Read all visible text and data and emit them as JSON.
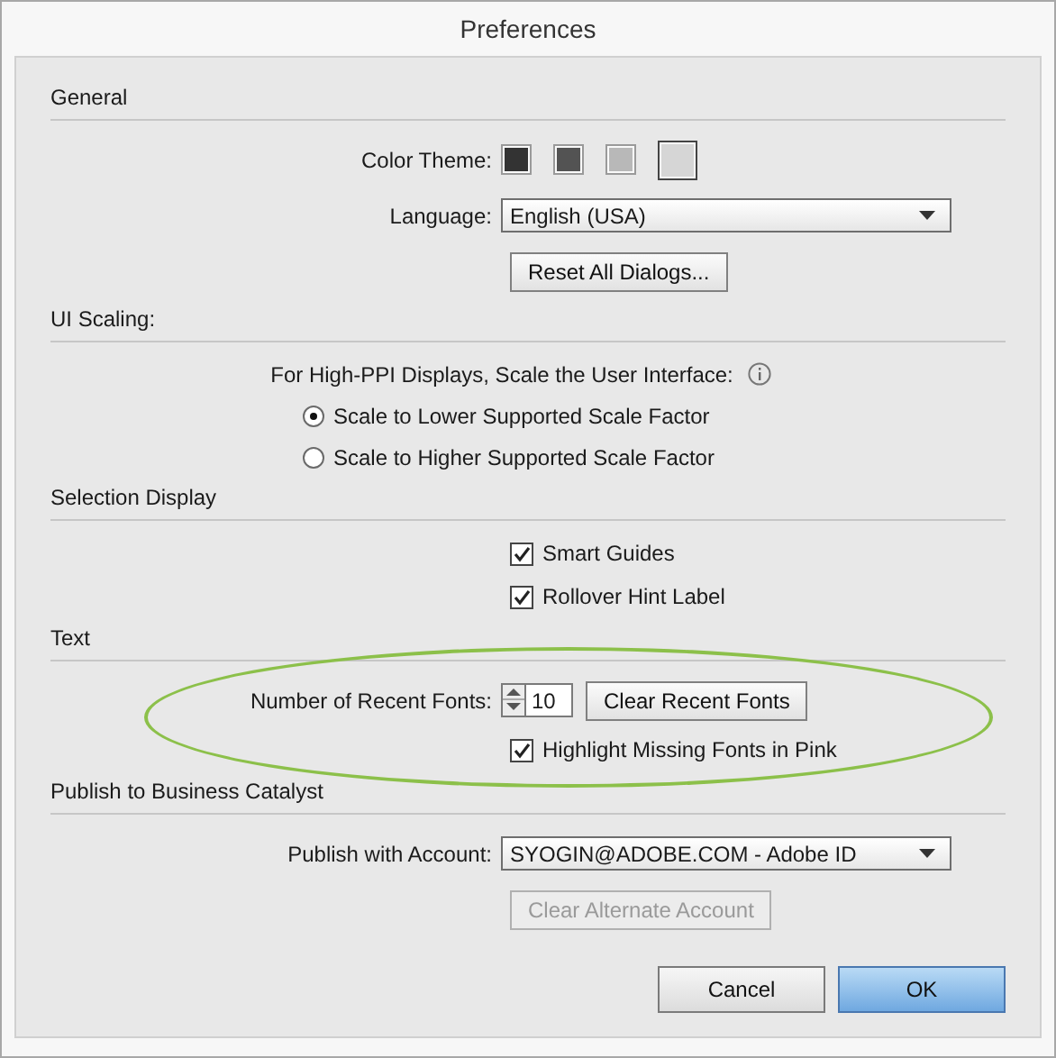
{
  "window": {
    "title": "Preferences"
  },
  "sections": [
    {
      "title": "General",
      "highlighted": false,
      "rows": [
        {
          "kind": "swatches",
          "label": "Color Theme:",
          "swatches": [
            {
              "color": "#333333",
              "selected": false
            },
            {
              "color": "#535353",
              "selected": false
            },
            {
              "color": "#b8b8b8",
              "selected": false
            },
            {
              "color": "#d6d6d6",
              "selected": true
            }
          ]
        },
        {
          "kind": "dropdown",
          "label": "Language:",
          "value": "English (USA)"
        },
        {
          "kind": "button",
          "text": "Reset All Dialogs...",
          "disabled": false
        }
      ]
    },
    {
      "title": "UI Scaling:",
      "highlighted": false,
      "rows": [
        {
          "kind": "note",
          "text": "For High-PPI Displays, Scale the User Interface:"
        },
        {
          "kind": "radio",
          "text": "Scale to Lower Supported Scale Factor",
          "selected": true
        },
        {
          "kind": "radio",
          "text": "Scale to Higher Supported Scale Factor",
          "selected": false
        }
      ]
    },
    {
      "title": "Selection Display",
      "highlighted": false,
      "rows": [
        {
          "kind": "checkbox",
          "text": "Smart Guides",
          "checked": true
        },
        {
          "kind": "checkbox",
          "text": "Rollover Hint Label",
          "checked": true
        }
      ]
    },
    {
      "title": "Text",
      "highlighted": true,
      "rows": [
        {
          "kind": "spinner",
          "label": "Number of Recent Fonts:",
          "value": "10",
          "button": "Clear Recent Fonts"
        },
        {
          "kind": "checkbox",
          "text": "Highlight Missing Fonts in Pink",
          "checked": true
        }
      ]
    },
    {
      "title": "Publish to Business Catalyst",
      "highlighted": false,
      "rows": [
        {
          "kind": "dropdown",
          "label": "Publish with Account:",
          "value": "SYOGIN@ADOBE.COM - Adobe ID"
        },
        {
          "kind": "button",
          "text": "Clear Alternate Account",
          "disabled": true
        }
      ]
    }
  ],
  "buttons": [
    {
      "label": "Cancel",
      "default": false
    },
    {
      "label": "OK",
      "default": true
    }
  ]
}
